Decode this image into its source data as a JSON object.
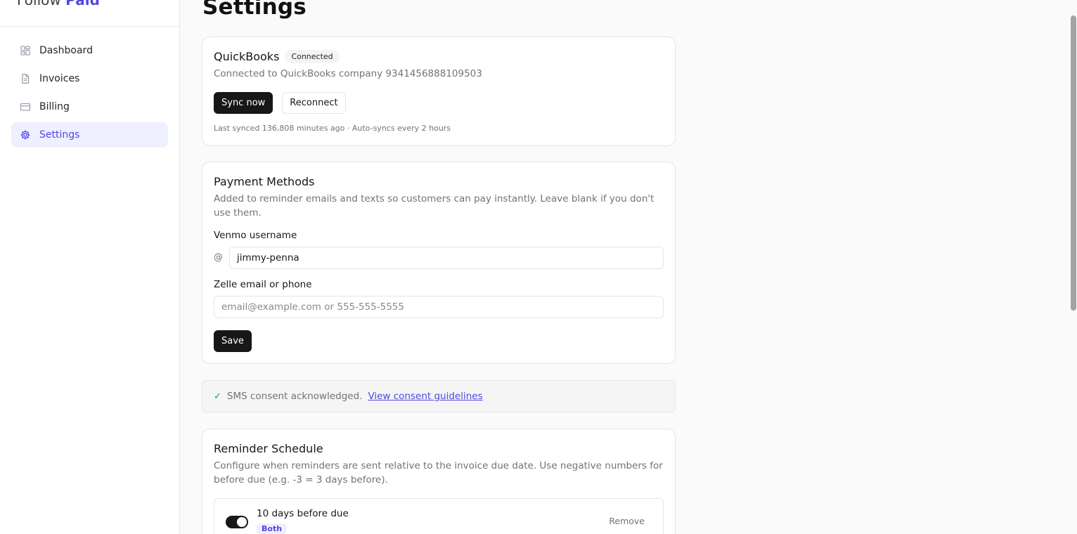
{
  "brand": {
    "part1": "Follow",
    "part2": "Paid",
    "accent": "#4f46e5"
  },
  "sidebar": {
    "items": [
      {
        "label": "Dashboard",
        "icon": "dashboard-icon",
        "active": false
      },
      {
        "label": "Invoices",
        "icon": "invoice-icon",
        "active": false
      },
      {
        "label": "Billing",
        "icon": "credit-card-icon",
        "active": false
      },
      {
        "label": "Settings",
        "icon": "gear-icon",
        "active": true
      }
    ]
  },
  "page": {
    "title": "Settings"
  },
  "quickbooks": {
    "title": "QuickBooks",
    "badge": "Connected",
    "description": "Connected to QuickBooks company 9341456888109503",
    "sync_label": "Sync now",
    "reconnect_label": "Reconnect",
    "meta": "Last synced 136,808 minutes ago · Auto-syncs every 2 hours"
  },
  "payment_methods": {
    "title": "Payment Methods",
    "description": "Added to reminder emails and texts so customers can pay instantly. Leave blank if you don't use them.",
    "venmo_label": "Venmo username",
    "venmo_prefix": "@",
    "venmo_value": "jimmy-penna",
    "zelle_label": "Zelle email or phone",
    "zelle_placeholder": "email@example.com or 555-555-5555",
    "save_label": "Save"
  },
  "consent": {
    "check": "✓",
    "text": "SMS consent acknowledged.",
    "link": "View consent guidelines"
  },
  "reminder_schedule": {
    "title": "Reminder Schedule",
    "description": "Configure when reminders are sent relative to the invoice due date. Use negative numbers for before due (e.g. -3 = 3 days before).",
    "rules": [
      {
        "label": "10 days before due",
        "channel": "Both",
        "enabled": true,
        "remove_label": "Remove"
      }
    ]
  }
}
